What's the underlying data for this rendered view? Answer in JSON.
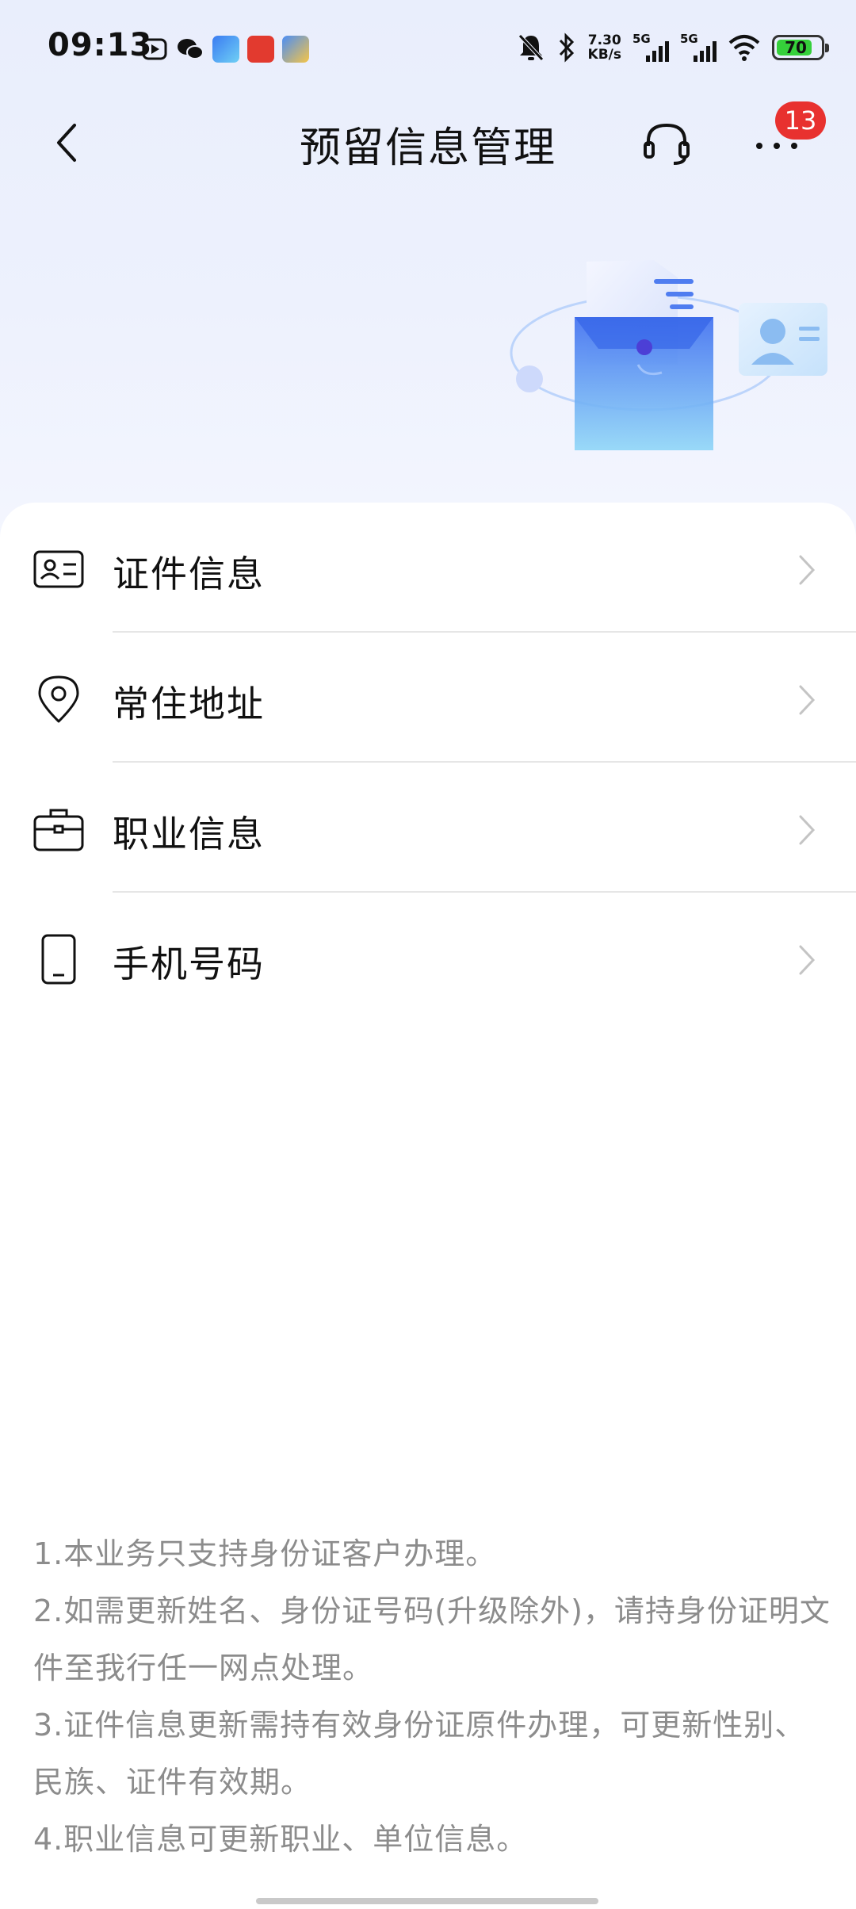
{
  "status_bar": {
    "time": "09:13",
    "net_speed": "7.30",
    "net_unit": "KB/s",
    "signal1": "5G",
    "signal2": "5G",
    "battery": "70",
    "icons": [
      "play-icon",
      "wechat-icon",
      "app-icon",
      "app-icon",
      "app-icon",
      "mute-bell-icon",
      "bluetooth-icon",
      "wifi-icon"
    ]
  },
  "header": {
    "title": "预留信息管理",
    "badge": "13"
  },
  "menu": [
    {
      "label": "证件信息",
      "icon": "id-card-icon"
    },
    {
      "label": "常住地址",
      "icon": "location-pin-icon"
    },
    {
      "label": "职业信息",
      "icon": "briefcase-icon"
    },
    {
      "label": "手机号码",
      "icon": "mobile-phone-icon"
    }
  ],
  "notes": [
    "1.本业务只支持身份证客户办理。",
    "2.如需更新姓名、身份证号码(升级除外)，请持身份证明文件至我行任一网点处理。",
    "3.证件信息更新需持有效身份证原件办理，可更新性别、民族、证件有效期。",
    "4.职业信息可更新职业、单位信息。"
  ],
  "colors": {
    "accent_blue": "#4f7df0",
    "badge_red": "#e8312f",
    "note_gray": "#8c8c8c"
  }
}
